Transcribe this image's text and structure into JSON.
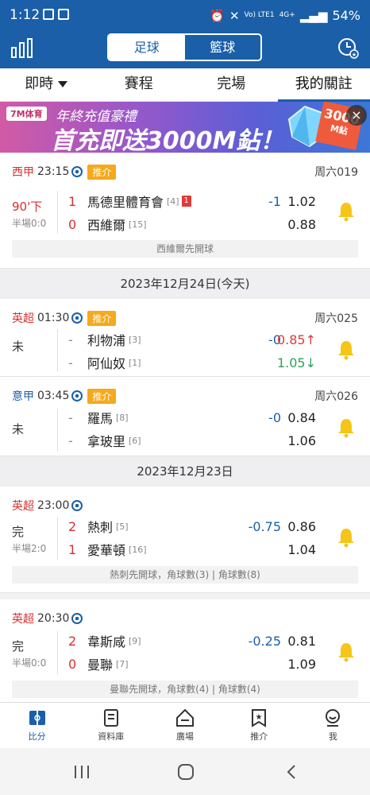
{
  "status_bar": {
    "time": "1:12",
    "battery": "54%",
    "net1": "Vo) LTE1",
    "net2": "4G+"
  },
  "header": {
    "seg_left": "足球",
    "seg_right": "籃球"
  },
  "tabs": [
    "即時",
    "賽程",
    "完場",
    "我的關註"
  ],
  "banner": {
    "brand": "7M体育",
    "line1": "年終充值豪禮",
    "line2": "首充即送3000M鉆！",
    "tag": "3000",
    "tag_unit": "M鉆",
    "close": "×"
  },
  "matches": [
    {
      "league": "西甲",
      "time": "23:15",
      "tag": "推介",
      "no": "周六019",
      "status": "90'下",
      "half": "半場0:0",
      "home": {
        "score": "1",
        "team": "馬德里體育會",
        "rank": "[4]",
        "redcard": "1",
        "odds": "1.02"
      },
      "away": {
        "score": "0",
        "team": "西維爾",
        "rank": "[15]",
        "odds": "0.88"
      },
      "handicap": "-1",
      "note": "西維爾先開球"
    },
    {
      "date": "2023年12月24日(今天)"
    },
    {
      "league": "英超",
      "time": "01:30",
      "tag": "推介",
      "no": "周六025",
      "status": "未",
      "home": {
        "score": "-",
        "team": "利物浦",
        "rank": "[3]",
        "odds": "0.85↑"
      },
      "away": {
        "score": "-",
        "team": "阿仙奴",
        "rank": "[1]",
        "odds": "1.05↓"
      },
      "handicap": "-0"
    },
    {
      "league": "意甲",
      "time": "03:45",
      "tag": "推介",
      "no": "周六026",
      "status": "未",
      "home": {
        "score": "-",
        "team": "羅馬",
        "rank": "[8]",
        "odds": "0.84"
      },
      "away": {
        "score": "-",
        "team": "拿玻里",
        "rank": "[6]",
        "odds": "1.06"
      },
      "handicap": "-0"
    },
    {
      "date": "2023年12月23日"
    },
    {
      "league": "英超",
      "time": "23:00",
      "status": "完",
      "half": "半場2:0",
      "home": {
        "score": "2",
        "team": "熱刺",
        "rank": "[5]",
        "odds": "0.86"
      },
      "away": {
        "score": "1",
        "team": "愛華頓",
        "rank": "[16]",
        "odds": "1.04"
      },
      "handicap": "-0.75",
      "note": "熱刺先開球，角球數(3) | 角球數(8)"
    },
    {
      "league": "英超",
      "time": "20:30",
      "status": "完",
      "half": "半場0:0",
      "home": {
        "score": "2",
        "team": "韋斯咸",
        "rank": "[9]",
        "odds": "0.81"
      },
      "away": {
        "score": "0",
        "team": "曼聯",
        "rank": "[7]",
        "odds": "1.09"
      },
      "handicap": "-0.25",
      "note": "曼聯先開球，角球數(4) | 角球數(4)"
    }
  ],
  "bottom_nav": [
    "比分",
    "資料庫",
    "廣場",
    "推介",
    "我"
  ],
  "colors": {
    "brand_blue": "#1a5fa8",
    "red": "#d93030",
    "green": "#2aa05a",
    "orange": "#f5a91c",
    "bell": "#f5c518"
  }
}
